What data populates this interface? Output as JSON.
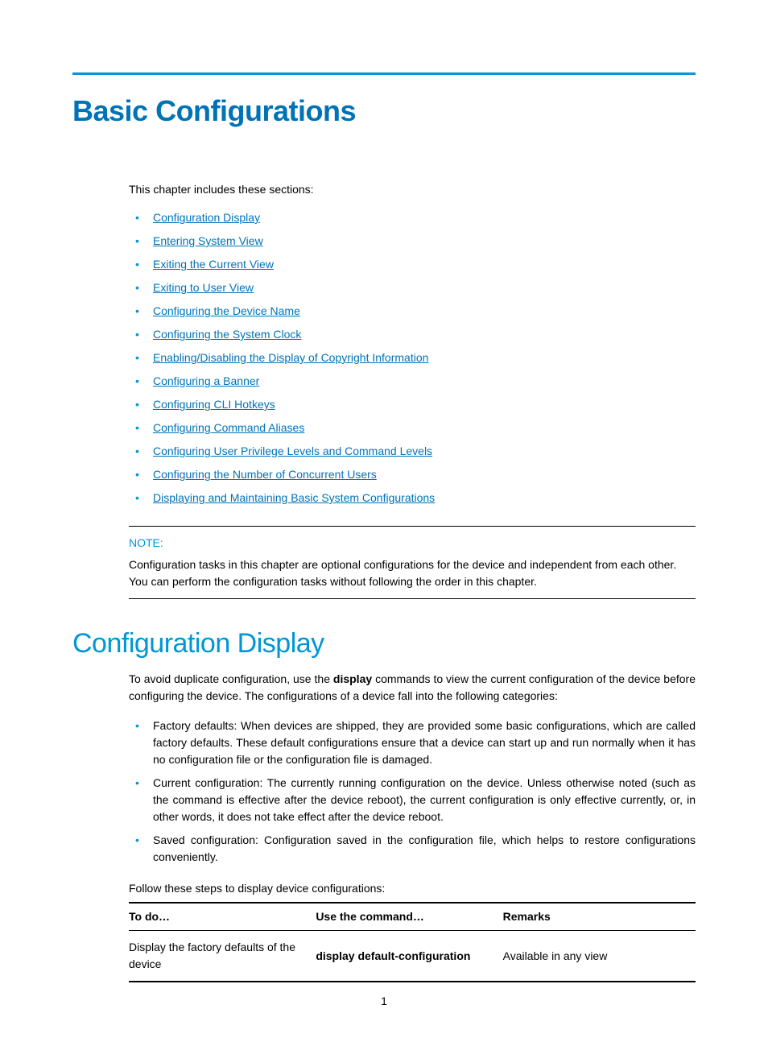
{
  "title": "Basic Configurations",
  "intro": "This chapter includes these sections:",
  "toc": [
    "Configuration Display",
    "Entering System View",
    "Exiting the Current View",
    "Exiting to User View",
    "Configuring the Device Name",
    "Configuring the System Clock",
    "Enabling/Disabling the Display of Copyright Information",
    "Configuring a Banner",
    "Configuring CLI Hotkeys",
    "Configuring Command Aliases",
    "Configuring User Privilege Levels and Command Levels",
    "Configuring the Number of Concurrent Users",
    "Displaying and Maintaining Basic System Configurations"
  ],
  "note": {
    "label": "NOTE:",
    "text": "Configuration tasks in this chapter are optional configurations for the device and independent from each other. You can perform the configuration tasks without following the order in this chapter."
  },
  "section": {
    "title": "Configuration Display",
    "p1_pre": "To avoid duplicate configuration, use the ",
    "p1_bold": "display",
    "p1_post": " commands to view the current configuration of the device before configuring the device. The configurations of a device fall into the following categories:",
    "bullets": [
      "Factory defaults: When devices are shipped, they are provided some basic configurations, which are called factory defaults. These default configurations ensure that a device can start up and run normally when it has no configuration file or the configuration file is damaged.",
      "Current configuration: The currently running configuration on the device. Unless otherwise noted (such as the command is effective after the device reboot), the current configuration is only effective currently, or, in other words, it does not take effect after the device reboot.",
      "Saved configuration: Configuration saved in the configuration file, which helps to restore configurations conveniently."
    ],
    "steps": "Follow these steps to display device configurations:"
  },
  "table": {
    "headers": {
      "todo": "To do…",
      "cmd": "Use the command…",
      "remarks": "Remarks"
    },
    "rows": [
      {
        "todo": "Display the factory defaults of the device",
        "cmd": "display default-configuration",
        "remarks": "Available in any view"
      }
    ]
  },
  "page_num": "1"
}
